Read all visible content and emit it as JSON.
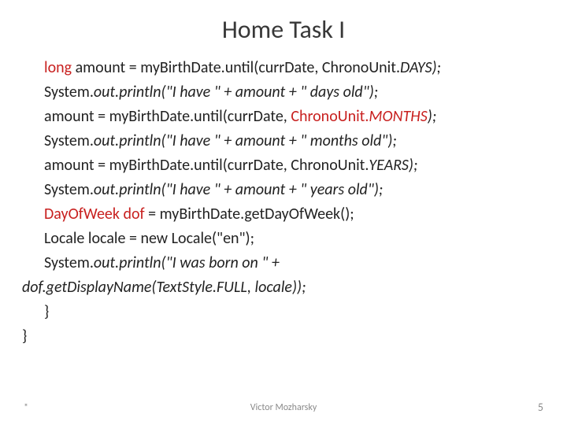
{
  "title": "Home Task I",
  "code": {
    "l1a": "long",
    "l1b": " amount = myBirthDate.until(currDate, ChronoUnit.",
    "l1c": "DAYS);",
    "l2a": "System.",
    "l2b": "out.println(\"I have \" + amount + \" days old\");",
    "l3a": "amount = myBirthDate.until(currDate, ",
    "l3b": "ChronoUnit.",
    "l3c": "MONTHS",
    "l3d": ");",
    "l4a": "System.",
    "l4b": "out.println(\"I have \" + amount + \" months old\");",
    "l5a": "amount = myBirthDate.until(currDate, ChronoUnit.",
    "l5b": "YEARS);",
    "l6a": "System.",
    "l6b": "out.println(\"I have \" + amount + \" years old\");",
    "l7a": "DayOfWeek dof",
    "l7b": " = myBirthDate.getDayOfWeek();",
    "l8": "Locale locale = new Locale(\"en\");",
    "l9a": "System.",
    "l9b": "out.println(\"I was born on \" + ",
    "l9c": "dof.getDisplayName(TextStyle.FULL, locale));",
    "l10": "}",
    "l11": "}"
  },
  "footer": {
    "bullet": "*",
    "author": "Victor Mozharsky",
    "page": "5"
  }
}
